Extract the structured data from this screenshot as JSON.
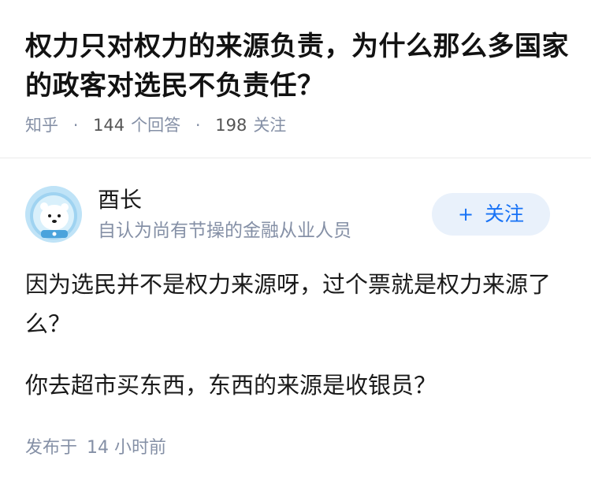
{
  "question": {
    "title": "权力只对权力的来源负责，为什么那么多国家的政客对选民不负责任？",
    "source": "知乎",
    "answer_count": "144",
    "answer_label": "个回答",
    "follower_count": "198",
    "follower_label": "关注"
  },
  "author": {
    "name": "酉长",
    "bio": "自认为尚有节操的金融从业人员",
    "avatar_icon": "polar-bear-astronaut-avatar",
    "follow_plus": "+",
    "follow_label": "关注"
  },
  "answer": {
    "paragraphs": [
      "因为选民并不是权力来源呀，过个票就是权力来源了么？",
      "你去超市买东西，东西的来源是收银员？"
    ],
    "published_label": "发布于",
    "published_time": "14 小时前"
  },
  "colors": {
    "accent": "#1772f6",
    "follow_bg": "#e9f1fb",
    "meta_gray": "#8590a6"
  }
}
